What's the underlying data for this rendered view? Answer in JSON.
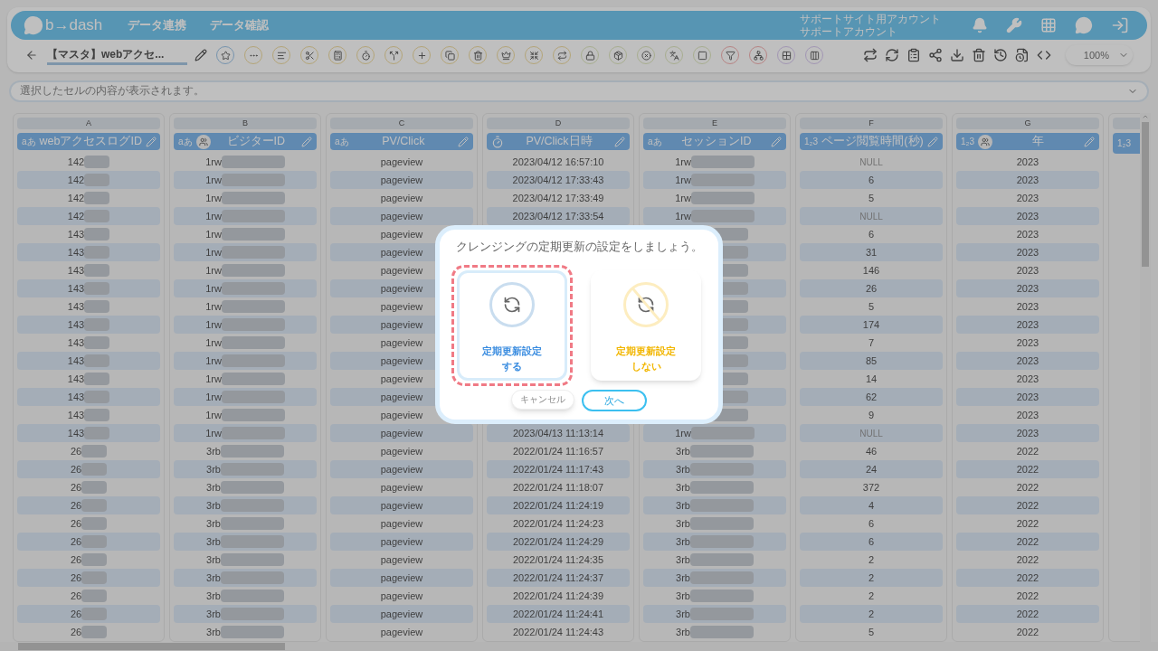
{
  "header": {
    "logo": "b→dash",
    "nav": [
      "データ連携",
      "データ確認"
    ],
    "account": [
      "サポートサイト用アカウント",
      "サポートアカウント"
    ]
  },
  "toolbar": {
    "title": "【マスタ】webアクセ...",
    "zoom": "100%"
  },
  "formula_bar": {
    "placeholder": "選択したセルの内容が表示されます。"
  },
  "columns": [
    {
      "letter": "A",
      "name": "webアクセスログID",
      "kind": "text",
      "type_label": "aあ",
      "group_icon": false,
      "redacted": true,
      "cells": [
        "142",
        "142",
        "142",
        "142",
        "143",
        "143",
        "143",
        "143",
        "143",
        "143",
        "143",
        "143",
        "143",
        "143",
        "143",
        "143",
        "26",
        "26",
        "26",
        "26",
        "26",
        "26",
        "26",
        "26",
        "26",
        "26",
        "26"
      ]
    },
    {
      "letter": "B",
      "name": "ビジターID",
      "kind": "text",
      "type_label": "aあ",
      "group_icon": true,
      "redacted": true,
      "cells": [
        "1rw",
        "1rw",
        "1rw",
        "1rw",
        "1rw",
        "1rw",
        "1rw",
        "1rw",
        "1rw",
        "1rw",
        "1rw",
        "1rw",
        "1rw",
        "1rw",
        "1rw",
        "1rw",
        "3rb",
        "3rb",
        "3rb",
        "3rb",
        "3rb",
        "3rb",
        "3rb",
        "3rb",
        "3rb",
        "3rb",
        "3rb"
      ]
    },
    {
      "letter": "C",
      "name": "PV/Click",
      "kind": "text",
      "type_label": "aあ",
      "group_icon": false,
      "redacted": false,
      "cells": [
        "pageview",
        "pageview",
        "pageview",
        "pageview",
        "pageview",
        "pageview",
        "pageview",
        "pageview",
        "pageview",
        "pageview",
        "pageview",
        "pageview",
        "pageview",
        "pageview",
        "pageview",
        "pageview",
        "pageview",
        "pageview",
        "pageview",
        "pageview",
        "pageview",
        "pageview",
        "pageview",
        "pageview",
        "pageview",
        "pageview",
        "pageview"
      ]
    },
    {
      "letter": "D",
      "name": "PV/Click日時",
      "kind": "datetime",
      "group_icon": false,
      "redacted": false,
      "cells": [
        "2023/04/12 16:57:10",
        "2023/04/12 17:33:43",
        "2023/04/12 17:33:49",
        "2023/04/12 17:33:54",
        null,
        null,
        null,
        null,
        null,
        null,
        null,
        null,
        null,
        null,
        null,
        "2023/04/13 11:13:14",
        "2022/01/24 11:16:57",
        "2022/01/24 11:17:43",
        "2022/01/24 11:18:07",
        "2022/01/24 11:24:19",
        "2022/01/24 11:24:23",
        "2022/01/24 11:24:29",
        "2022/01/24 11:24:35",
        "2022/01/24 11:24:37",
        "2022/01/24 11:24:39",
        "2022/01/24 11:24:41",
        "2022/01/24 11:24:43"
      ]
    },
    {
      "letter": "E",
      "name": "セッションID",
      "kind": "text",
      "type_label": "aあ",
      "group_icon": false,
      "redacted": true,
      "cells": [
        "1rw",
        "1rw",
        "1rw",
        "1rw",
        null,
        null,
        null,
        null,
        null,
        null,
        null,
        null,
        null,
        null,
        null,
        "1rw",
        "3rb",
        "3rb",
        "3rb",
        "3rb",
        "3rb",
        "3rb",
        "3rb",
        "3rb",
        "3rb",
        "3rb",
        "3rb"
      ]
    },
    {
      "letter": "F",
      "name": "ページ閲覧時間(秒)",
      "kind": "number",
      "type_label": "1₂3",
      "group_icon": false,
      "redacted": false,
      "cells": [
        {
          "text": "NULL",
          "kind": "null"
        },
        "6",
        "5",
        {
          "text": "NULL",
          "kind": "null"
        },
        "6",
        "31",
        "146",
        "26",
        "5",
        "174",
        "7",
        "85",
        "14",
        "62",
        "9",
        {
          "text": "NULL",
          "kind": "null"
        },
        "46",
        "24",
        "372",
        "4",
        "6",
        "6",
        "2",
        "2",
        "2",
        "2",
        "5"
      ]
    },
    {
      "letter": "G",
      "name": "年",
      "kind": "number",
      "type_label": "1₂3",
      "group_icon": true,
      "redacted": false,
      "cells": [
        "2023",
        "2023",
        "2023",
        "2023",
        "2023",
        "2023",
        "2023",
        "2023",
        "2023",
        "2023",
        "2023",
        "2023",
        "2023",
        "2023",
        "2023",
        "2023",
        "2022",
        "2022",
        "2022",
        "2022",
        "2022",
        "2022",
        "2022",
        "2022",
        "2022",
        "2022",
        "2022"
      ]
    },
    {
      "kind": "number",
      "type_label": "1₂3",
      "group_icon": false
    }
  ],
  "dialog": {
    "prompt": "クレンジングの定期更新の設定をしましょう。",
    "options": [
      {
        "kind": "enable",
        "lines": [
          "定期更新設定",
          "する"
        ],
        "selected": true
      },
      {
        "kind": "disable",
        "lines": [
          "定期更新設定",
          "しない"
        ],
        "selected": false
      }
    ],
    "buttons": [
      {
        "kind": "cancel",
        "label": "キャンセル"
      },
      {
        "kind": "next",
        "label": "次へ"
      }
    ]
  }
}
